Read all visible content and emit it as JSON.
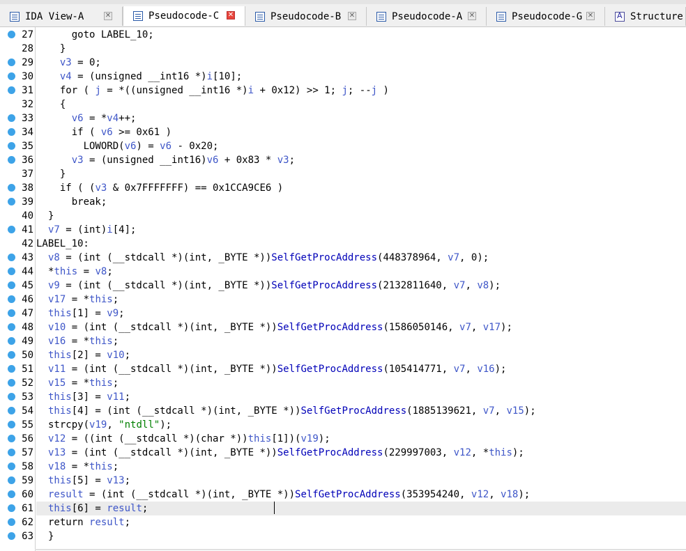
{
  "tabs": [
    {
      "label": "IDA View-A",
      "icon": "ida-view-icon",
      "active": false
    },
    {
      "label": "Pseudocode-C",
      "icon": "pseudocode-icon",
      "active": true
    },
    {
      "label": "Pseudocode-B",
      "icon": "pseudocode-icon",
      "active": false
    },
    {
      "label": "Pseudocode-A",
      "icon": "pseudocode-icon",
      "active": false
    },
    {
      "label": "Pseudocode-G",
      "icon": "pseudocode-icon",
      "active": false
    },
    {
      "label": "Structure",
      "icon": "structure-icon",
      "active": false
    }
  ],
  "colors": {
    "variable": "#3e56c8",
    "string": "#008000",
    "function": "#0000b8",
    "breakpoint_dot": "#3da3e8",
    "active_close": "#e8453c"
  },
  "current_line": 61,
  "lines": [
    {
      "n": "27",
      "dot": true,
      "segs": [
        [
          "    goto LABEL_10;",
          "k"
        ]
      ]
    },
    {
      "n": "28",
      "dot": false,
      "segs": [
        [
          "  }",
          "k"
        ]
      ]
    },
    {
      "n": "29",
      "dot": true,
      "segs": [
        [
          "  ",
          "k"
        ],
        [
          "v3",
          "v"
        ],
        [
          " = 0;",
          "k"
        ]
      ]
    },
    {
      "n": "30",
      "dot": true,
      "segs": [
        [
          "  ",
          "k"
        ],
        [
          "v4",
          "v"
        ],
        [
          " = (unsigned __int16 *)",
          "k"
        ],
        [
          "i",
          "v"
        ],
        [
          "[10];",
          "k"
        ]
      ]
    },
    {
      "n": "31",
      "dot": true,
      "segs": [
        [
          "  for ( ",
          "k"
        ],
        [
          "j",
          "v"
        ],
        [
          " = *((unsigned __int16 *)",
          "k"
        ],
        [
          "i",
          "v"
        ],
        [
          " + 0x12) >> 1; ",
          "k"
        ],
        [
          "j",
          "v"
        ],
        [
          "; --",
          "k"
        ],
        [
          "j",
          "v"
        ],
        [
          " )",
          "k"
        ]
      ]
    },
    {
      "n": "32",
      "dot": false,
      "segs": [
        [
          "  {",
          "k"
        ]
      ]
    },
    {
      "n": "33",
      "dot": true,
      "segs": [
        [
          "    ",
          "k"
        ],
        [
          "v6",
          "v"
        ],
        [
          " = *",
          "k"
        ],
        [
          "v4",
          "v"
        ],
        [
          "++;",
          "k"
        ]
      ]
    },
    {
      "n": "34",
      "dot": true,
      "segs": [
        [
          "    if ( ",
          "k"
        ],
        [
          "v6",
          "v"
        ],
        [
          " >= 0x61 )",
          "k"
        ]
      ]
    },
    {
      "n": "35",
      "dot": true,
      "segs": [
        [
          "      LOWORD(",
          "k"
        ],
        [
          "v6",
          "v"
        ],
        [
          ") = ",
          "k"
        ],
        [
          "v6",
          "v"
        ],
        [
          " - 0x20;",
          "k"
        ]
      ]
    },
    {
      "n": "36",
      "dot": true,
      "segs": [
        [
          "    ",
          "k"
        ],
        [
          "v3",
          "v"
        ],
        [
          " = (unsigned __int16)",
          "k"
        ],
        [
          "v6",
          "v"
        ],
        [
          " + 0x83 * ",
          "k"
        ],
        [
          "v3",
          "v"
        ],
        [
          ";",
          "k"
        ]
      ]
    },
    {
      "n": "37",
      "dot": false,
      "segs": [
        [
          "  }",
          "k"
        ]
      ]
    },
    {
      "n": "38",
      "dot": true,
      "segs": [
        [
          "  if ( (",
          "k"
        ],
        [
          "v3",
          "v"
        ],
        [
          " & 0x7FFFFFFF) == 0x1CCA9CE6 )",
          "k"
        ]
      ]
    },
    {
      "n": "39",
      "dot": true,
      "segs": [
        [
          "    break;",
          "k"
        ]
      ]
    },
    {
      "n": "40",
      "dot": false,
      "segs": [
        [
          "}",
          "k"
        ]
      ]
    },
    {
      "n": "41",
      "dot": true,
      "segs": [
        [
          "",
          "k"
        ],
        [
          "v7",
          "v"
        ],
        [
          " = (int)",
          "k"
        ],
        [
          "i",
          "v"
        ],
        [
          "[4];",
          "k"
        ]
      ]
    },
    {
      "n": "42",
      "dot": false,
      "label": true,
      "segs": [
        [
          "LABEL_10:",
          "k"
        ]
      ]
    },
    {
      "n": "43",
      "dot": true,
      "segs": [
        [
          "",
          "k"
        ],
        [
          "v8",
          "v"
        ],
        [
          " = (int (__stdcall *)(int, _BYTE *))",
          "k"
        ],
        [
          "SelfGetProcAddress",
          "f"
        ],
        [
          "(448378964, ",
          "k"
        ],
        [
          "v7",
          "v"
        ],
        [
          ", 0);",
          "k"
        ]
      ]
    },
    {
      "n": "44",
      "dot": true,
      "segs": [
        [
          "*",
          "k"
        ],
        [
          "this",
          "v"
        ],
        [
          " = ",
          "k"
        ],
        [
          "v8",
          "v"
        ],
        [
          ";",
          "k"
        ]
      ]
    },
    {
      "n": "45",
      "dot": true,
      "segs": [
        [
          "",
          "k"
        ],
        [
          "v9",
          "v"
        ],
        [
          " = (int (__stdcall *)(int, _BYTE *))",
          "k"
        ],
        [
          "SelfGetProcAddress",
          "f"
        ],
        [
          "(2132811640, ",
          "k"
        ],
        [
          "v7",
          "v"
        ],
        [
          ", ",
          "k"
        ],
        [
          "v8",
          "v"
        ],
        [
          ");",
          "k"
        ]
      ]
    },
    {
      "n": "46",
      "dot": true,
      "segs": [
        [
          "",
          "k"
        ],
        [
          "v17",
          "v"
        ],
        [
          " = *",
          "k"
        ],
        [
          "this",
          "v"
        ],
        [
          ";",
          "k"
        ]
      ]
    },
    {
      "n": "47",
      "dot": true,
      "segs": [
        [
          "",
          "k"
        ],
        [
          "this",
          "v"
        ],
        [
          "[1] = ",
          "k"
        ],
        [
          "v9",
          "v"
        ],
        [
          ";",
          "k"
        ]
      ]
    },
    {
      "n": "48",
      "dot": true,
      "segs": [
        [
          "",
          "k"
        ],
        [
          "v10",
          "v"
        ],
        [
          " = (int (__stdcall *)(int, _BYTE *))",
          "k"
        ],
        [
          "SelfGetProcAddress",
          "f"
        ],
        [
          "(1586050146, ",
          "k"
        ],
        [
          "v7",
          "v"
        ],
        [
          ", ",
          "k"
        ],
        [
          "v17",
          "v"
        ],
        [
          ");",
          "k"
        ]
      ]
    },
    {
      "n": "49",
      "dot": true,
      "segs": [
        [
          "",
          "k"
        ],
        [
          "v16",
          "v"
        ],
        [
          " = *",
          "k"
        ],
        [
          "this",
          "v"
        ],
        [
          ";",
          "k"
        ]
      ]
    },
    {
      "n": "50",
      "dot": true,
      "segs": [
        [
          "",
          "k"
        ],
        [
          "this",
          "v"
        ],
        [
          "[2] = ",
          "k"
        ],
        [
          "v10",
          "v"
        ],
        [
          ";",
          "k"
        ]
      ]
    },
    {
      "n": "51",
      "dot": true,
      "segs": [
        [
          "",
          "k"
        ],
        [
          "v11",
          "v"
        ],
        [
          " = (int (__stdcall *)(int, _BYTE *))",
          "k"
        ],
        [
          "SelfGetProcAddress",
          "f"
        ],
        [
          "(105414771, ",
          "k"
        ],
        [
          "v7",
          "v"
        ],
        [
          ", ",
          "k"
        ],
        [
          "v16",
          "v"
        ],
        [
          ");",
          "k"
        ]
      ]
    },
    {
      "n": "52",
      "dot": true,
      "segs": [
        [
          "",
          "k"
        ],
        [
          "v15",
          "v"
        ],
        [
          " = *",
          "k"
        ],
        [
          "this",
          "v"
        ],
        [
          ";",
          "k"
        ]
      ]
    },
    {
      "n": "53",
      "dot": true,
      "segs": [
        [
          "",
          "k"
        ],
        [
          "this",
          "v"
        ],
        [
          "[3] = ",
          "k"
        ],
        [
          "v11",
          "v"
        ],
        [
          ";",
          "k"
        ]
      ]
    },
    {
      "n": "54",
      "dot": true,
      "segs": [
        [
          "",
          "k"
        ],
        [
          "this",
          "v"
        ],
        [
          "[4] = (int (__stdcall *)(int, _BYTE *))",
          "k"
        ],
        [
          "SelfGetProcAddress",
          "f"
        ],
        [
          "(1885139621, ",
          "k"
        ],
        [
          "v7",
          "v"
        ],
        [
          ", ",
          "k"
        ],
        [
          "v15",
          "v"
        ],
        [
          ");",
          "k"
        ]
      ]
    },
    {
      "n": "55",
      "dot": true,
      "segs": [
        [
          "strcpy(",
          "k"
        ],
        [
          "v19",
          "v"
        ],
        [
          ", ",
          "k"
        ],
        [
          "\"ntdll\"",
          "s"
        ],
        [
          ");",
          "k"
        ]
      ]
    },
    {
      "n": "56",
      "dot": true,
      "segs": [
        [
          "",
          "k"
        ],
        [
          "v12",
          "v"
        ],
        [
          " = ((int (__stdcall *)(char *))",
          "k"
        ],
        [
          "this",
          "v"
        ],
        [
          "[1])(",
          "k"
        ],
        [
          "v19",
          "v"
        ],
        [
          ");",
          "k"
        ]
      ]
    },
    {
      "n": "57",
      "dot": true,
      "segs": [
        [
          "",
          "k"
        ],
        [
          "v13",
          "v"
        ],
        [
          " = (int (__stdcall *)(int, _BYTE *))",
          "k"
        ],
        [
          "SelfGetProcAddress",
          "f"
        ],
        [
          "(229997003, ",
          "k"
        ],
        [
          "v12",
          "v"
        ],
        [
          ", *",
          "k"
        ],
        [
          "this",
          "v"
        ],
        [
          ");",
          "k"
        ]
      ]
    },
    {
      "n": "58",
      "dot": true,
      "segs": [
        [
          "",
          "k"
        ],
        [
          "v18",
          "v"
        ],
        [
          " = *",
          "k"
        ],
        [
          "this",
          "v"
        ],
        [
          ";",
          "k"
        ]
      ]
    },
    {
      "n": "59",
      "dot": true,
      "segs": [
        [
          "",
          "k"
        ],
        [
          "this",
          "v"
        ],
        [
          "[5] = ",
          "k"
        ],
        [
          "v13",
          "v"
        ],
        [
          ";",
          "k"
        ]
      ]
    },
    {
      "n": "60",
      "dot": true,
      "segs": [
        [
          "",
          "k"
        ],
        [
          "result",
          "v"
        ],
        [
          " = (int (__stdcall *)(int, _BYTE *))",
          "k"
        ],
        [
          "SelfGetProcAddress",
          "f"
        ],
        [
          "(353954240, ",
          "k"
        ],
        [
          "v12",
          "v"
        ],
        [
          ", ",
          "k"
        ],
        [
          "v18",
          "v"
        ],
        [
          ");",
          "k"
        ]
      ]
    },
    {
      "n": "61",
      "dot": true,
      "segs": [
        [
          "",
          "k"
        ],
        [
          "this",
          "v"
        ],
        [
          "[6] = ",
          "k"
        ],
        [
          "result",
          "v"
        ],
        [
          ";",
          "k"
        ]
      ]
    },
    {
      "n": "62",
      "dot": true,
      "segs": [
        [
          "return ",
          "k"
        ],
        [
          "result",
          "v"
        ],
        [
          ";",
          "k"
        ]
      ]
    },
    {
      "n": "63",
      "dot": true,
      "segs": [
        [
          "}",
          "k"
        ]
      ]
    }
  ]
}
